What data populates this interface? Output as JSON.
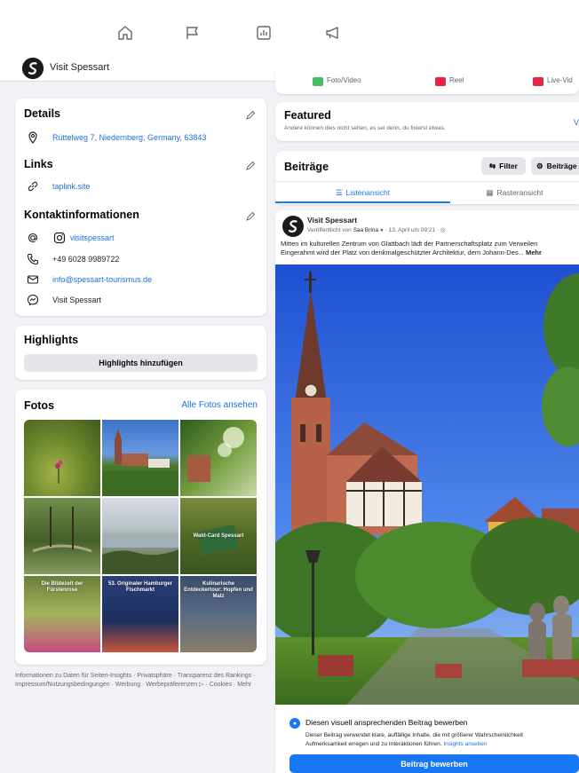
{
  "header": {
    "page_name": "Visit Spessart"
  },
  "details": {
    "title": "Details",
    "address": "Rüttelweg 7, Niedernberg, Germany, 63843"
  },
  "links": {
    "title": "Links",
    "url": "taplink.site"
  },
  "contact": {
    "title": "Kontaktinformationen",
    "instagram": "visitspessart",
    "phone": "+49 6028 9989722",
    "email": "info@spessart-tourismus.de",
    "messenger": "Visit Spessart"
  },
  "highlights": {
    "title": "Highlights",
    "button": "Highlights hinzufügen"
  },
  "photos": {
    "title": "Fotos",
    "see_all": "Alle Fotos ansehen",
    "overlay_1": "Wald-Card Spessart",
    "overlay_2": "Die Blütezeit der Fürstenrose",
    "overlay_3": "53. Originaler Hamburger Fischmarkt",
    "overlay_4": "Kulinarische Entdeckertour: Hopfen und Malz"
  },
  "footer": {
    "text": "Informationen zu Daten für Seiten-Insights · Privatsphäre · Transparenz des Rankings · Impressum/Nutzungsbedingungen · Werbung · Werbepräferenzen ▷ · Cookies · Mehr"
  },
  "composer": {
    "photo_video": "Foto/Video",
    "reel": "Reel",
    "live": "Live-Vid"
  },
  "featured": {
    "title": "Featured",
    "subtitle": "Andere können dies nicht sehen, es sei denn, du fixierst etwas.",
    "action": "V"
  },
  "posts": {
    "title": "Beiträge",
    "filter": "Filter",
    "manage": "Beiträge v",
    "tab_list": "Listenansicht",
    "tab_grid": "Rasteransicht"
  },
  "post": {
    "author": "Visit Spessart",
    "published_by": "Veröffentlicht von",
    "publisher": "Saa Brina",
    "date": "13. April um 09:21",
    "text_line1": "Mitten im kulturellen Zentrum von Glattbach lädt der Partnerschaftsplatz zum Verweilen",
    "text_line2": "Eingerahmt wird der Platz von denkmalgeschützter Architektur, dem Johann-Des...",
    "more": "Mehr"
  },
  "boost": {
    "title": "Diesen visuell ansprechenden Beitrag bewerben",
    "body1": "Dieser Beitrag verwendet klare, auffällige Inhalte, die mit größerer Wahrscheinlichkeit",
    "body2": "Aufmerksamkeit erregen und zu Interaktionen führen.",
    "insights_link": "Insights ansehen",
    "button": "Beitrag bewerben"
  }
}
